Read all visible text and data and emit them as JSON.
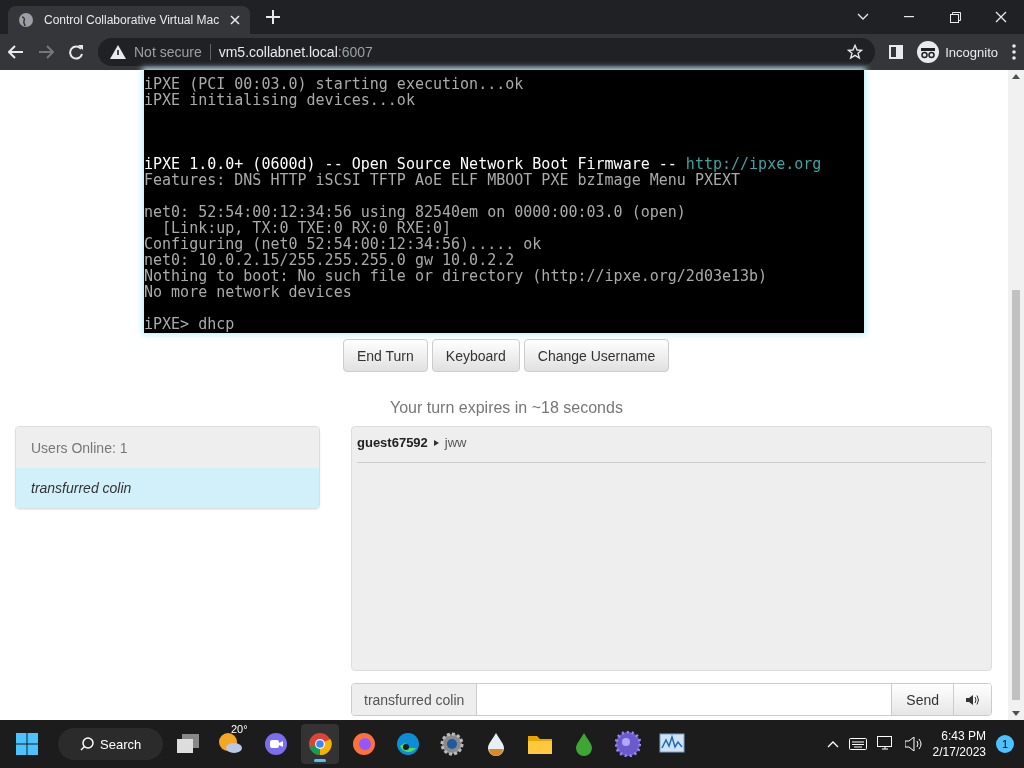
{
  "browser": {
    "tab_title": "Control Collaborative Virtual Mac",
    "security": "Not secure",
    "url_host": "vm5.collabnet.local",
    "url_port": ":6007",
    "profile": "Incognito"
  },
  "terminal": {
    "lines": [
      {
        "kind": "text",
        "segments": [
          {
            "text": "iPXE (PCI 00:03.0) starting execution...ok",
            "kind": "normal"
          }
        ]
      },
      {
        "kind": "text",
        "segments": [
          {
            "text": "iPXE initialising devices...ok",
            "kind": "normal"
          }
        ]
      },
      {
        "kind": "blank"
      },
      {
        "kind": "blank"
      },
      {
        "kind": "blank"
      },
      {
        "kind": "text",
        "segments": [
          {
            "text": "iPXE 1.0.0+ (0600d) -- Open Source Network Boot Firmware -- ",
            "kind": "bright"
          },
          {
            "text": "http://ipxe.org",
            "kind": "link"
          }
        ]
      },
      {
        "kind": "text",
        "segments": [
          {
            "text": "Features: DNS HTTP iSCSI TFTP AoE ELF MBOOT PXE bzImage Menu PXEXT",
            "kind": "normal"
          }
        ]
      },
      {
        "kind": "blank"
      },
      {
        "kind": "text",
        "segments": [
          {
            "text": "net0: 52:54:00:12:34:56 using 82540em on 0000:00:03.0 (open)",
            "kind": "normal"
          }
        ]
      },
      {
        "kind": "text",
        "segments": [
          {
            "text": "  [Link:up, TX:0 TXE:0 RX:0 RXE:0]",
            "kind": "normal"
          }
        ]
      },
      {
        "kind": "text",
        "segments": [
          {
            "text": "Configuring (net0 52:54:00:12:34:56)..... ok",
            "kind": "normal"
          }
        ]
      },
      {
        "kind": "text",
        "segments": [
          {
            "text": "net0: 10.0.2.15/255.255.255.0 gw 10.0.2.2",
            "kind": "normal"
          }
        ]
      },
      {
        "kind": "text",
        "segments": [
          {
            "text": "Nothing to boot: No such file or directory (http://ipxe.org/2d03e13b)",
            "kind": "normal"
          }
        ]
      },
      {
        "kind": "text",
        "segments": [
          {
            "text": "No more network devices",
            "kind": "normal"
          }
        ]
      },
      {
        "kind": "blank"
      },
      {
        "kind": "text",
        "segments": [
          {
            "text": "iPXE> dhcp",
            "kind": "normal"
          }
        ]
      }
    ]
  },
  "controls": [
    "End Turn",
    "Keyboard",
    "Change Username"
  ],
  "turn_notice": "Your turn expires in ~18 seconds",
  "users": {
    "header": "Users Online: 1",
    "items": [
      {
        "name": "transfurred colin",
        "selected": true
      }
    ]
  },
  "chat": {
    "messages": [
      {
        "user": "guest67592",
        "text": "jww"
      }
    ]
  },
  "chat_input": {
    "username": "transfurred colin",
    "send": "Send"
  },
  "taskbar": {
    "search": "Search",
    "apps": [
      {
        "kind": "taskview",
        "selected": false
      },
      {
        "kind": "weather",
        "label": "20°",
        "selected": false
      },
      {
        "kind": "meet",
        "selected": false
      },
      {
        "kind": "chrome",
        "selected": true
      },
      {
        "kind": "firefox",
        "selected": false
      },
      {
        "kind": "edge",
        "selected": false
      },
      {
        "kind": "settings",
        "selected": false
      },
      {
        "kind": "droplet",
        "selected": false
      },
      {
        "kind": "folder",
        "selected": false
      },
      {
        "kind": "greendrop",
        "selected": false
      },
      {
        "kind": "spiky",
        "selected": false
      },
      {
        "kind": "monitor",
        "selected": false
      }
    ],
    "time": "6:43 PM",
    "date": "2/17/2023",
    "notifications": "1"
  }
}
